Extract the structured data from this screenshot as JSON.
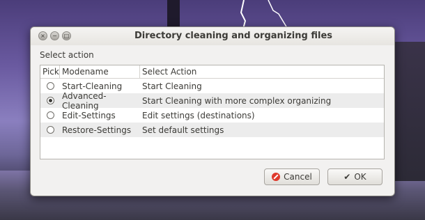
{
  "window": {
    "title": "Directory cleaning and organizing files",
    "buttons": {
      "close": "×",
      "minimize": "−",
      "maximize": "□"
    }
  },
  "section_label": "Select action",
  "table": {
    "headers": [
      "Pick",
      "Modename",
      "Select Action"
    ],
    "rows": [
      {
        "checked": false,
        "mode": "Start-Cleaning",
        "action": "Start Cleaning"
      },
      {
        "checked": true,
        "mode": "Advanced-Cleaning",
        "action": "Start Cleaning with more complex organizing"
      },
      {
        "checked": false,
        "mode": "Edit-Settings",
        "action": "Edit settings (destinations)"
      },
      {
        "checked": false,
        "mode": "Restore-Settings",
        "action": "Set default settings"
      }
    ]
  },
  "buttons": {
    "cancel_label": "Cancel",
    "ok_label": "OK",
    "ok_icon": "✔"
  },
  "colors": {
    "cancel_icon": "#df3a2c",
    "alt_row": "#ececec"
  }
}
